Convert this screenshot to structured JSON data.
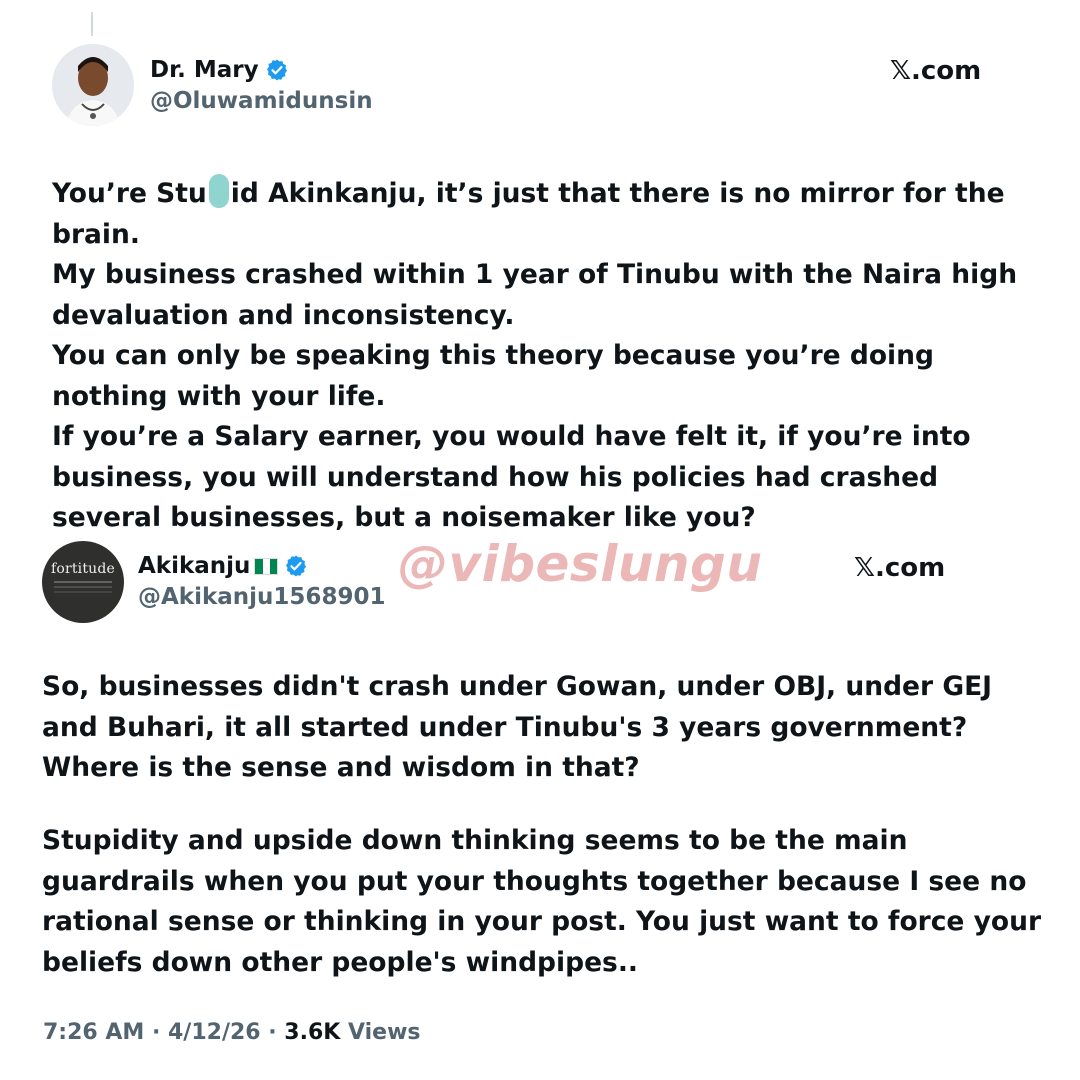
{
  "tweet1": {
    "name": "Dr. Mary",
    "handle": "@Oluwamidunsin",
    "brand": "𝕏.com",
    "text": {
      "line1_a": "You’re Stu",
      "line1_b": "id Akinkanju, it’s just that there is no mirror for the",
      "line2": "brain.",
      "line3": "My business crashed within 1 year of Tinubu with the Naira high",
      "line4": "devaluation and inconsistency.",
      "line5": "You can only be speaking this theory because you’re doing",
      "line6": "nothing with your life.",
      "line7": "If you’re a Salary earner, you would have felt it, if you’re into",
      "line8": "business, you will understand how his policies had crashed",
      "line9": "several businesses, but a noisemaker like you?"
    }
  },
  "tweet2": {
    "name": "Akikanju",
    "handle": "@Akikanju1568901",
    "brand": "𝕏.com",
    "avatar_text": "fortitude",
    "text": {
      "line1": "So, businesses didn't crash under Gowan, under OBJ, under GEJ",
      "line2": "and Buhari, it all started under Tinubu's 3 years government?",
      "line3": "Where is the sense and wisdom in that?",
      "line4": "Stupidity and upside down thinking seems to be the main",
      "line5": "guardrails when you put your thoughts together because I see no",
      "line6": "rational sense or thinking in your post. You just want to force your",
      "line7": "beliefs down other people's windpipes.."
    },
    "meta": {
      "time": "7:26 AM",
      "sep1": " · ",
      "date": "4/12/26",
      "sep2": " · ",
      "views_count": "3.6K",
      "views_label": " Views"
    }
  },
  "watermark": "@vibeslungu",
  "colors": {
    "verified": "#1d9bf0",
    "text": "#0f1419",
    "secondary": "#536471",
    "watermark": "#e8aaaa",
    "censor": "#8fd4cf",
    "flag_green": "#008751"
  }
}
